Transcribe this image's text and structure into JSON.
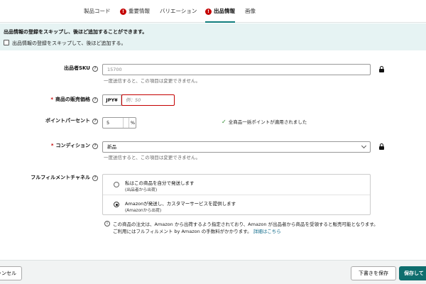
{
  "tabs": [
    {
      "label": "製品コード",
      "error": false,
      "active": false
    },
    {
      "label": "重要情報",
      "error": true,
      "active": false
    },
    {
      "label": "バリエーション",
      "error": false,
      "active": false
    },
    {
      "label": "出品情報",
      "error": true,
      "active": true
    },
    {
      "label": "画像",
      "error": false,
      "active": false
    }
  ],
  "tab_error_glyph": "!",
  "banner": {
    "title": "出品情報の登録をスキップし、後ほど追加することができます。",
    "checkbox_label": "出品情報の登録をスキップして、後ほど追加する。"
  },
  "help_glyph": "?",
  "required_mark": "*",
  "fields": {
    "sku": {
      "label": "出品者SKU",
      "value": "15700",
      "hint": "一度送信すると、この項目は変更できません。"
    },
    "price": {
      "label": "商品の販売価格",
      "currency": "JPY¥",
      "placeholder": "例：50"
    },
    "points": {
      "label": "ポイントパーセント",
      "value": "5",
      "unit": "%",
      "message": "全商品一括ポイントが適用されました",
      "message_icon": "✓"
    },
    "condition": {
      "label": "コンディション",
      "value": "新品",
      "hint": "一度送信すると、この項目は変更できません。"
    },
    "fulfillment": {
      "label": "フルフィルメントチャネル",
      "options": [
        {
          "main": "私はこの商品を自分で発送します",
          "sub": "(出品者から出荷)",
          "checked": false
        },
        {
          "main": "Amazonが発送し、カスタマーサービスを提供します",
          "sub": "(Amazonから出荷)",
          "checked": true
        }
      ]
    }
  },
  "info": {
    "icon": "i",
    "text": "この商品の注文は、Amazon から出荷するよう指定されており、Amazon が出品者から商品を受領すると販売可能となります。ご利用にはフルフィルメント by Amazon の手数料がかかります。",
    "link": "詳細はこちら"
  },
  "footer": {
    "cancel": "キャンセル",
    "draft": "下書きを保存",
    "save": "保存して"
  },
  "colors": {
    "accent": "#0f6e6e",
    "error": "#c40000",
    "banner_bg": "#e6f3f3",
    "success": "#2a8a2a"
  }
}
